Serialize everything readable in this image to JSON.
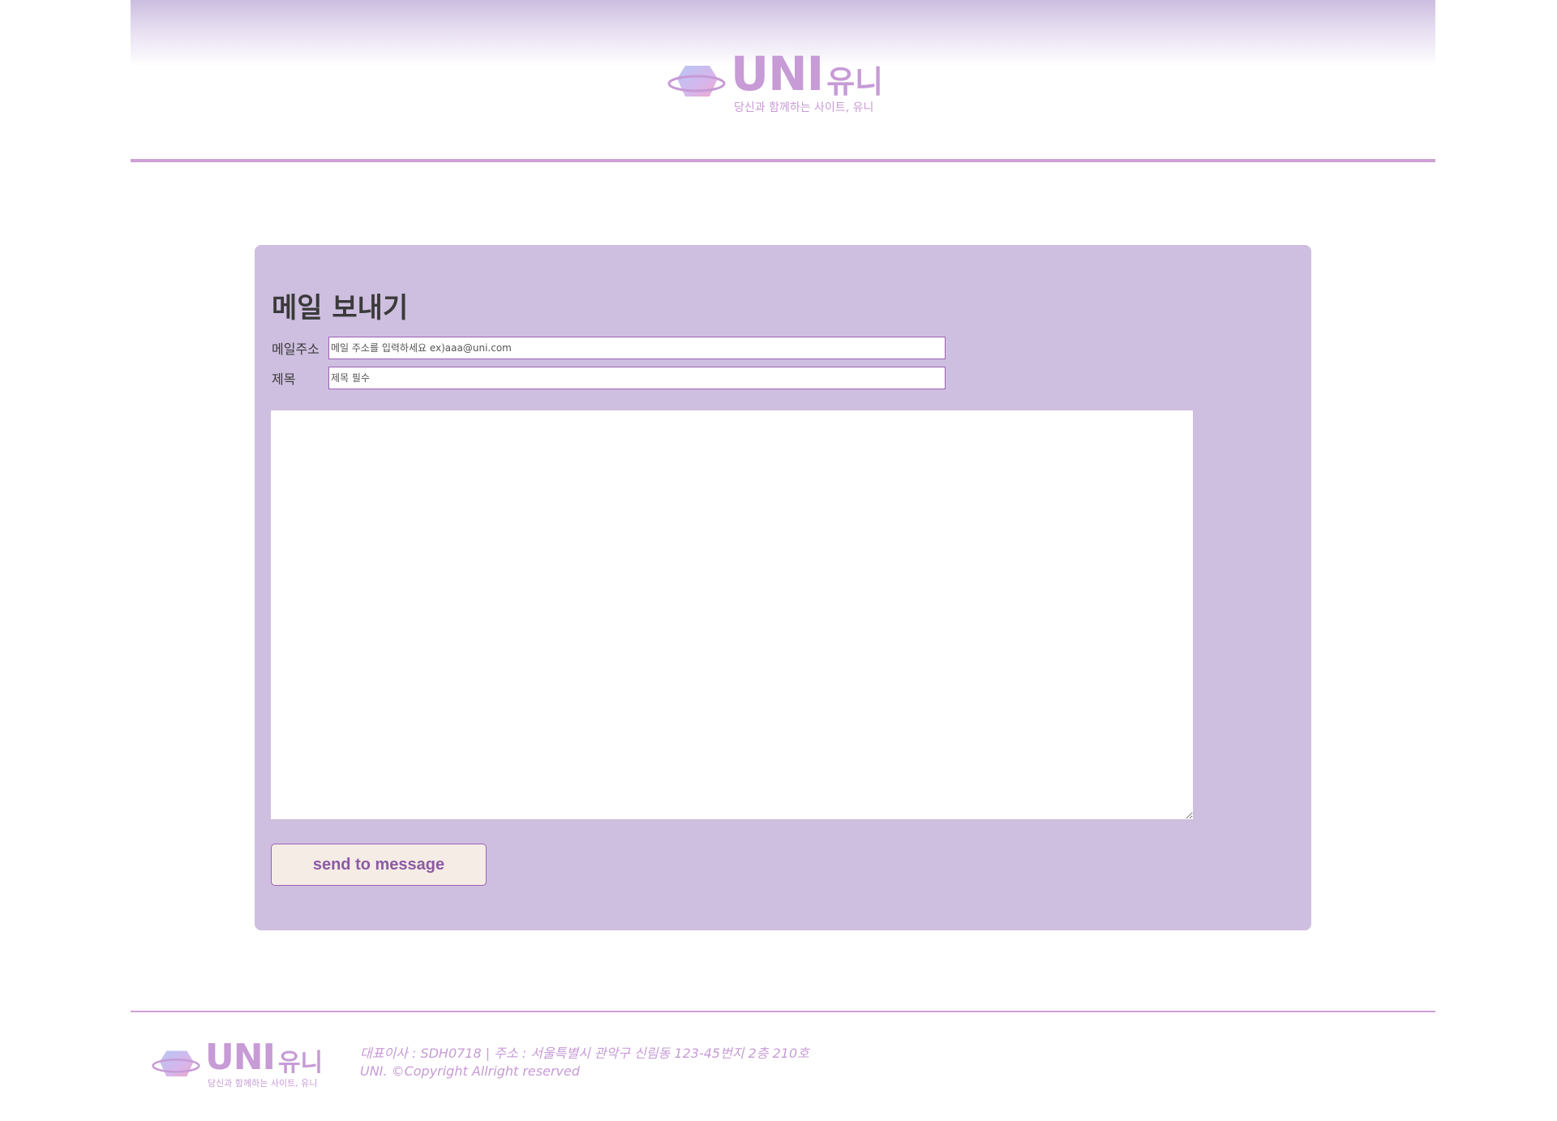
{
  "brand": {
    "name": "UNI",
    "name_korean": "유니",
    "tagline": "당신과 함께하는 사이트, 유니"
  },
  "colors": {
    "accent": "#c79bd6",
    "panel_bg": "#cebfe0",
    "button_bg": "#f5ece6",
    "button_text": "#8c5aa3",
    "input_border": "#9a62b3"
  },
  "mail_form": {
    "title": "메일 보내기",
    "email_label": "메일주소",
    "email_placeholder": "메일 주소를 입력하세요 ex)aaa@uni.com",
    "subject_label": "제목",
    "subject_placeholder": "제목 필수",
    "message_value": "",
    "send_label": "send to message"
  },
  "footer": {
    "info_line1": "대표이사 : SDH0718 | 주소 : 서울특별시 관악구 신림동 123-45번지 2층 210호",
    "info_line2": "UNI. ©Copyright Allright reserved"
  }
}
